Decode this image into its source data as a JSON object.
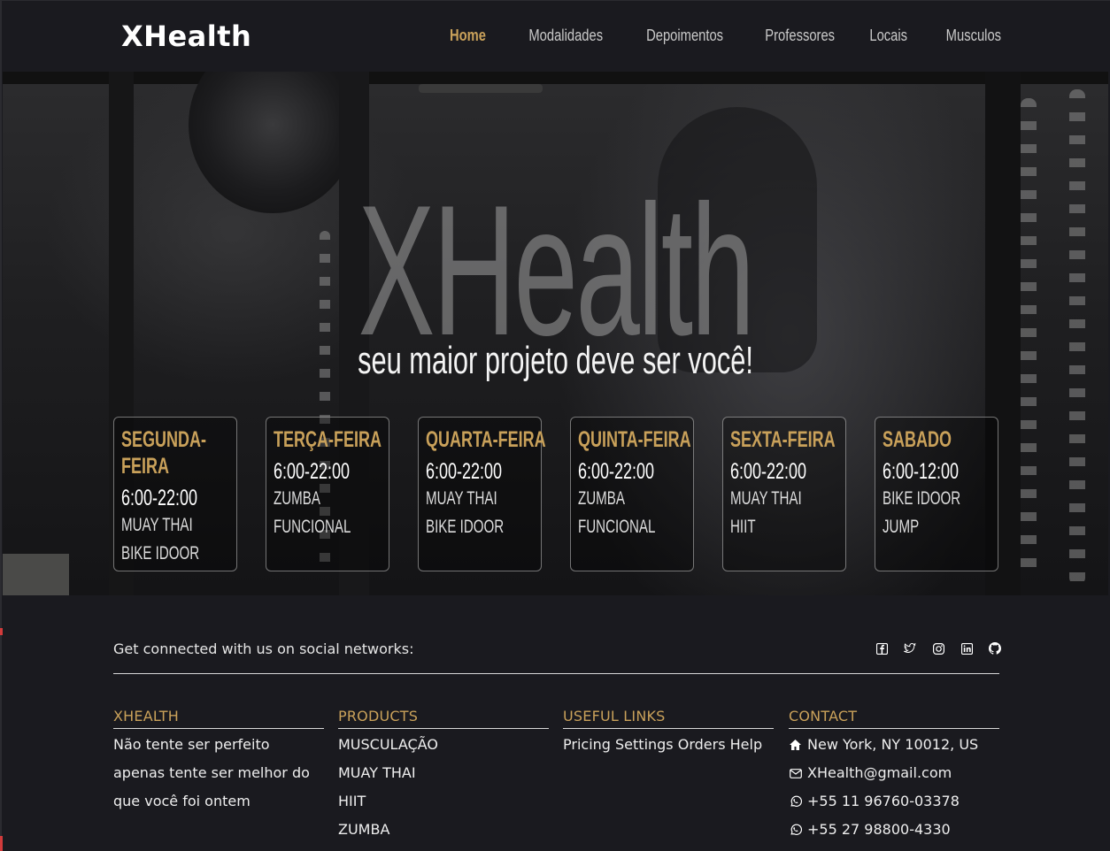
{
  "nav": {
    "brand": "XHealth",
    "links": [
      "Home",
      "Modalidades",
      "Depoimentos",
      "Professores",
      "Locais",
      "Musculos"
    ]
  },
  "hero": {
    "title": "XHealth",
    "subtitle": "seu maior projeto deve ser você!"
  },
  "schedule": [
    {
      "day": "SEGUNDA-\nFEIRA",
      "hours": "6:00-22:00",
      "classes": [
        "MUAY THAI",
        "BIKE IDOOR"
      ]
    },
    {
      "day": "TERÇA-FEIRA",
      "hours": "6:00-22:00",
      "classes": [
        "ZUMBA",
        "FUNCIONAL"
      ]
    },
    {
      "day": "QUARTA-FEIRA",
      "hours": "6:00-22:00",
      "classes": [
        "MUAY THAI",
        "BIKE IDOOR"
      ]
    },
    {
      "day": "QUINTA-FEIRA",
      "hours": "6:00-22:00",
      "classes": [
        "ZUMBA",
        "FUNCIONAL"
      ]
    },
    {
      "day": "SEXTA-FEIRA",
      "hours": "6:00-22:00",
      "classes": [
        "MUAY THAI",
        "HIIT"
      ]
    },
    {
      "day": "SABADO",
      "hours": "6:00-12:00",
      "classes": [
        "BIKE IDOOR",
        "JUMP"
      ]
    }
  ],
  "footer": {
    "social_text": "Get connected with us on social networks:",
    "social_icons": [
      "facebook-icon",
      "twitter-icon",
      "instagram-icon",
      "linkedin-icon",
      "github-icon"
    ],
    "about": {
      "heading": "XHEALTH",
      "lines": [
        "Não tente ser perfeito",
        "apenas tente ser melhor do",
        "que você foi ontem"
      ]
    },
    "products": {
      "heading": "PRODUCTS",
      "items": [
        "MUSCULAÇÃO",
        "MUAY THAI",
        "HIIT",
        "ZUMBA"
      ]
    },
    "links": {
      "heading": "USEFUL LINKS",
      "text": "Pricing Settings Orders Help"
    },
    "contact": {
      "heading": "CONTACT",
      "address": "New York, NY 10012, US",
      "email": "XHealth@gmail.com",
      "phone1": "+55 11 96760-03378",
      "phone2": "+55 27 98800-4330"
    }
  },
  "colors": {
    "accent": "#c9a15a",
    "background": "#1a1a1f"
  }
}
